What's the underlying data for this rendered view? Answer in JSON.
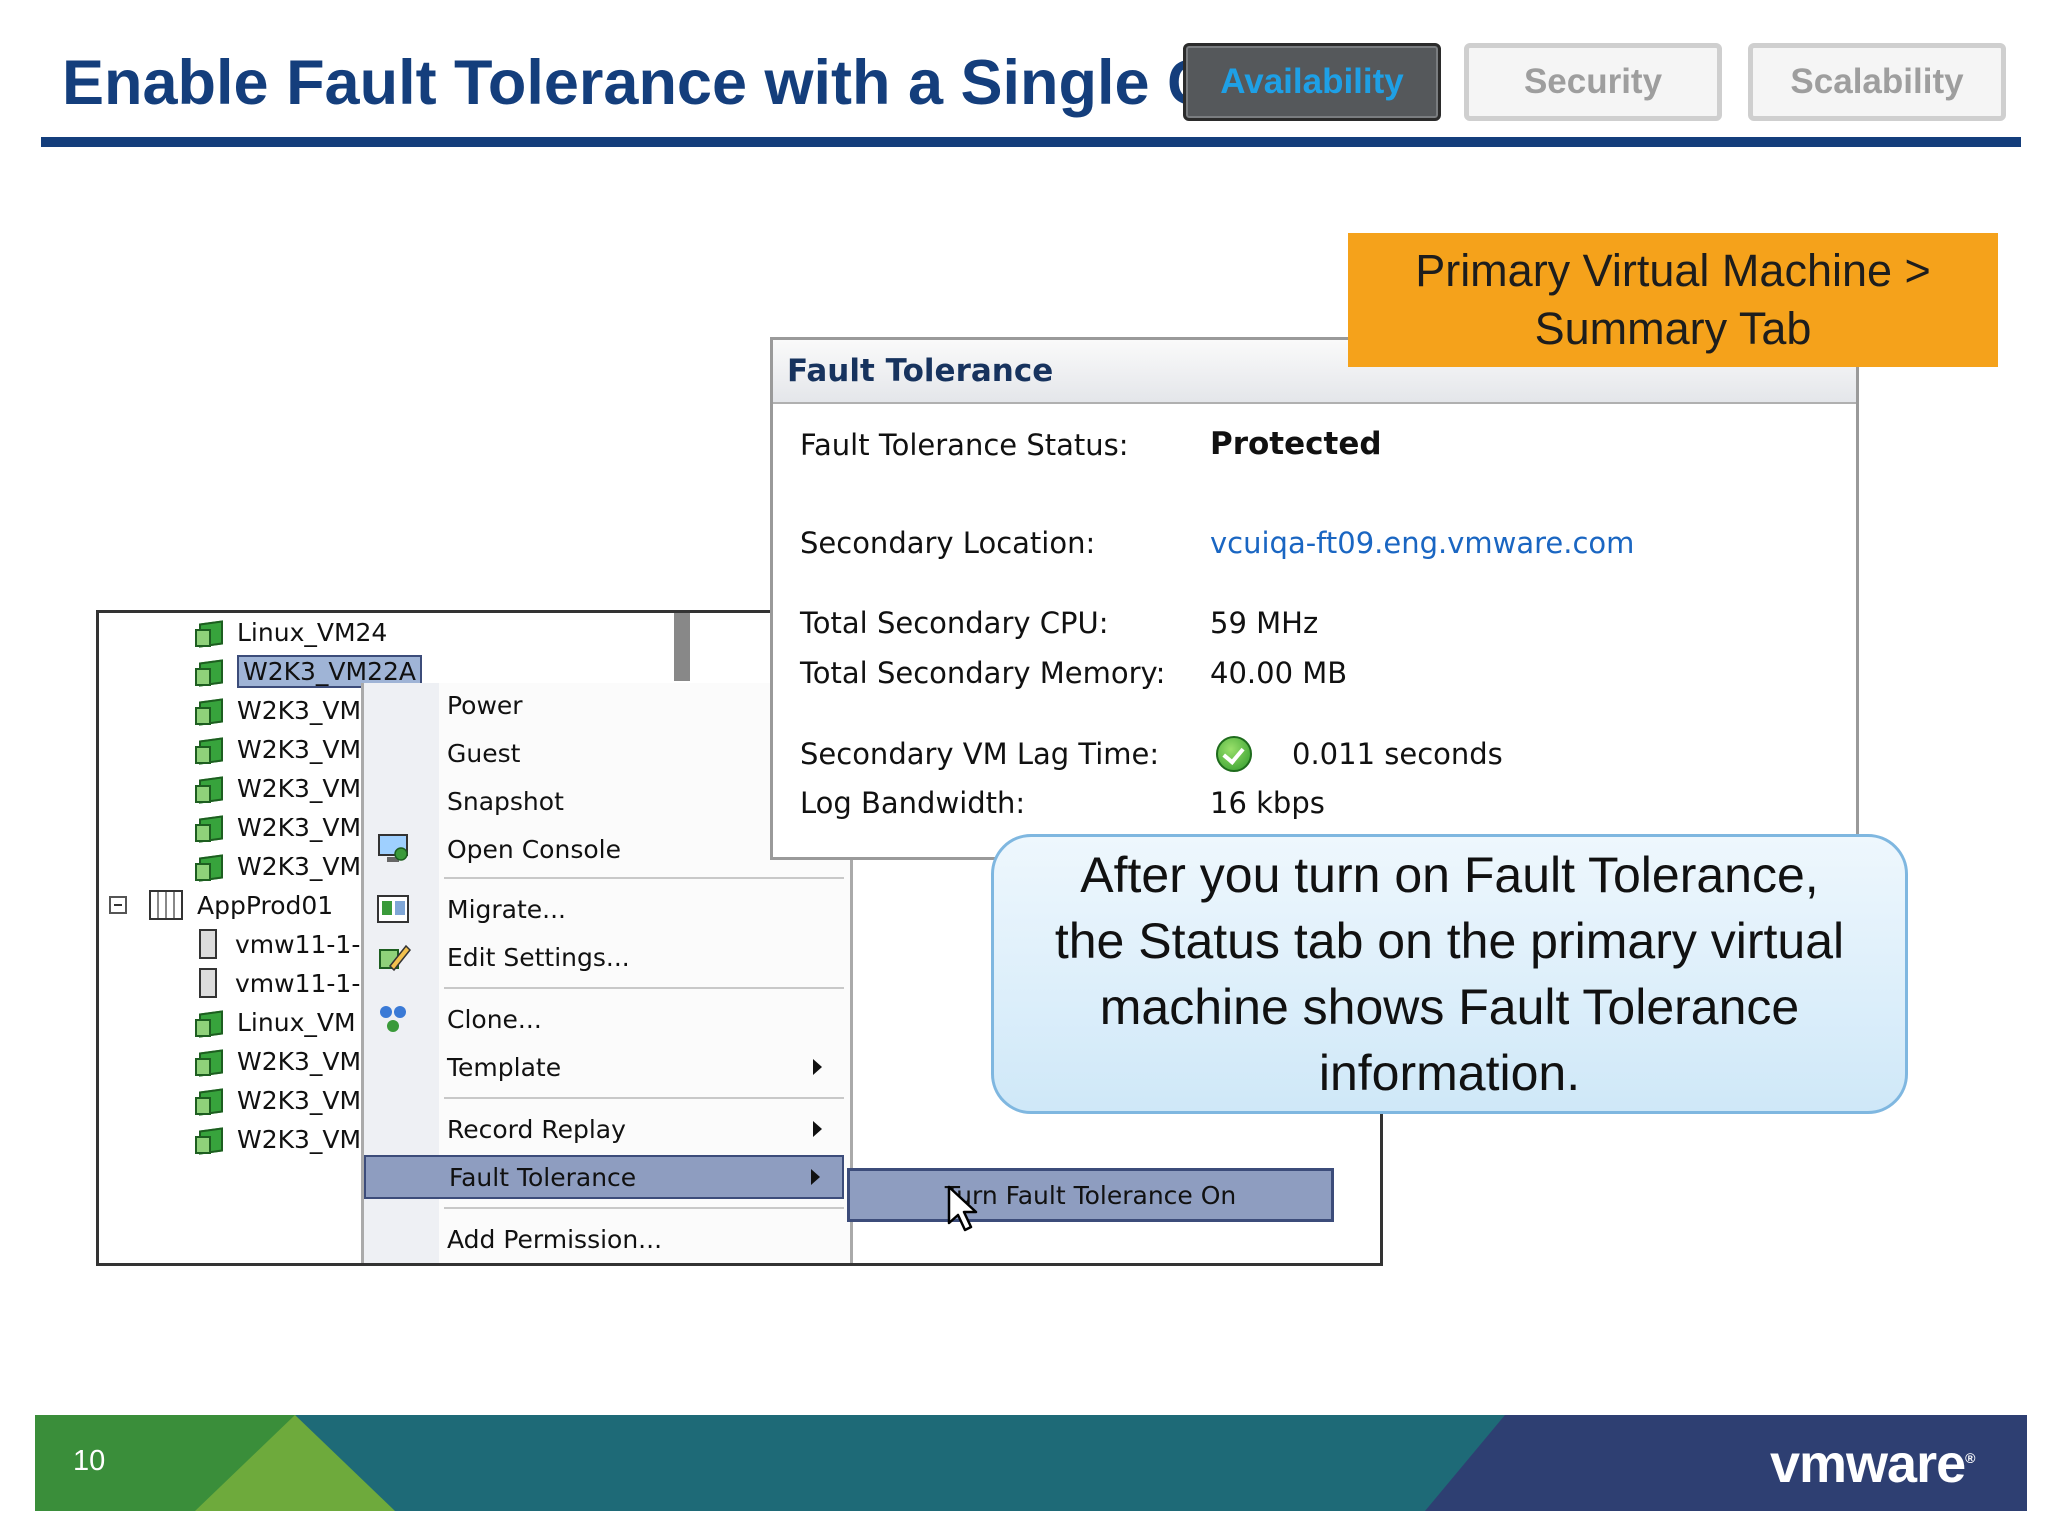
{
  "slide": {
    "title": "Enable Fault Tolerance with a Single Click",
    "page_number": "10",
    "logo": "vmware"
  },
  "tabs": [
    {
      "label": "Availability",
      "active": true
    },
    {
      "label": "Security",
      "active": false
    },
    {
      "label": "Scalability",
      "active": false
    }
  ],
  "callouts": {
    "orange_line1": "Primary Virtual Machine >",
    "orange_line2": "Summary Tab",
    "blue": "After you turn on Fault Tolerance, the Status tab on the primary virtual machine shows Fault Tolerance information."
  },
  "tree": {
    "items": [
      {
        "label": "Linux_VM24",
        "type": "vm"
      },
      {
        "label": "W2K3_VM22A",
        "type": "vm"
      },
      {
        "label": "W2K3_VM",
        "type": "vm"
      },
      {
        "label": "W2K3_VM",
        "type": "vm"
      },
      {
        "label": "W2K3_VM",
        "type": "vm"
      },
      {
        "label": "W2K3_VM",
        "type": "vm"
      },
      {
        "label": "W2K3_VM",
        "type": "vm"
      },
      {
        "label": "AppProd01",
        "type": "datacenter"
      },
      {
        "label": "vmw11-1-",
        "type": "host"
      },
      {
        "label": "vmw11-1-",
        "type": "host"
      },
      {
        "label": "Linux_VM",
        "type": "vm"
      },
      {
        "label": "W2K3_VM",
        "type": "vm"
      },
      {
        "label": "W2K3_VM",
        "type": "vm"
      },
      {
        "label": "W2K3_VM",
        "type": "vm"
      }
    ]
  },
  "menu": {
    "items": [
      {
        "label": "Power"
      },
      {
        "label": "Guest"
      },
      {
        "label": "Snapshot"
      },
      {
        "label": "Open Console"
      },
      {
        "label": "Migrate..."
      },
      {
        "label": "Edit Settings..."
      },
      {
        "label": "Clone..."
      },
      {
        "label": "Template"
      },
      {
        "label": "Record Replay"
      },
      {
        "label": "Fault Tolerance"
      },
      {
        "label": "Add Permission..."
      }
    ],
    "submenu_item": "Turn Fault Tolerance On"
  },
  "fault_tolerance": {
    "title": "Fault Tolerance",
    "status_label": "Fault Tolerance Status:",
    "status_value": "Protected",
    "location_label": "Secondary Location:",
    "location_value": "vcuiqa-ft09.eng.vmware.com",
    "cpu_label": "Total Secondary CPU:",
    "cpu_value": "59 MHz",
    "memory_label": "Total Secondary Memory:",
    "memory_value": "40.00 MB",
    "lag_label": "Secondary VM Lag Time:",
    "lag_value": "0.011 seconds",
    "bandwidth_label": "Log Bandwidth:",
    "bandwidth_value": "16 kbps"
  },
  "colors": {
    "title": "#143e7c",
    "orange": "#f5a21b",
    "link": "#1a66c2",
    "active_tab_text": "#1ea0e6"
  }
}
